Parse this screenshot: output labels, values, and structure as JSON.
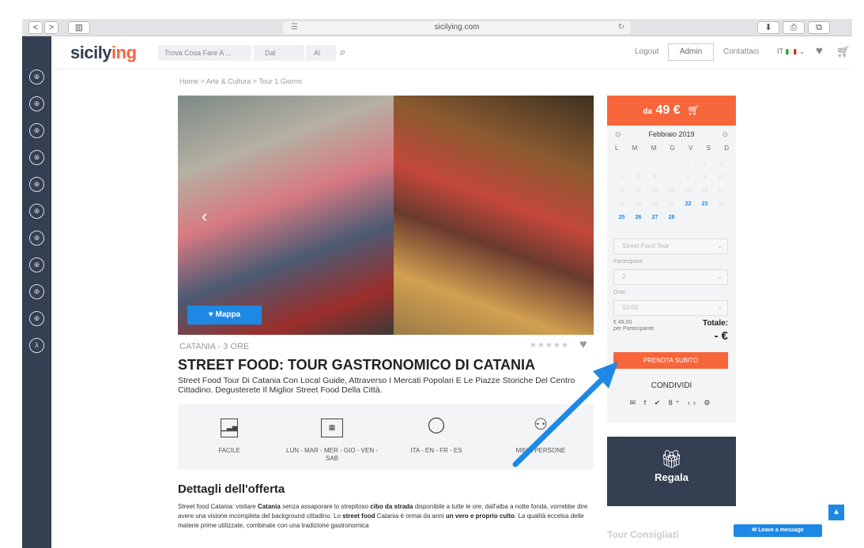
{
  "browser": {
    "url": "sicilying.com",
    "back": "<",
    "forward": ">",
    "sidebar_toggle": "▥",
    "menu": "☰",
    "reload": "↻"
  },
  "header": {
    "logo_main": "sicily",
    "logo_accent": "ing",
    "search_placeholder": "Trova Cosa Fare A ...",
    "from_placeholder": "Dal",
    "to_placeholder": "Al",
    "logout": "Logout",
    "admin": "Admin",
    "contacts": "Contattaci",
    "lang": "IT"
  },
  "breadcrumb": "Home > Arte & Cultura > Tour 1 Giorno",
  "hero": {
    "map_label": "♥ Mappa"
  },
  "tour": {
    "meta": "CATANIA - 3 ORE",
    "stars": "★★★★★",
    "title": "STREET FOOD: TOUR GASTRONOMICO DI CATANIA",
    "subtitle": "Street Food Tour Di Catania Con Local Guide, Attraverso I Mercati Popolari E Le Piazze Storiche Del Centro Cittadino. Degusterete Il Miglior Street Food Della Città."
  },
  "features": [
    {
      "label": "FACILE"
    },
    {
      "label": "LUN - MAR - MER - GIO - VEN - SAB"
    },
    {
      "label": "ITA - EN - FR - ES"
    },
    {
      "label": "MIN 2 PERSONE"
    }
  ],
  "details": {
    "heading": "Dettagli dell'offerta",
    "p1": "Street food Catania: visitare ",
    "b1": "Catania",
    "p2": " senza assaporare lo strepitoso ",
    "b2": "cibo da strada",
    "p3": " disponibile a tutte le ore, dall'alba a notte fonda, vorrebbe dire avere una visione incompleta del background cittadino. Lo ",
    "b3": "street food",
    "p4": " Catania è ormai da anni ",
    "b4": "un vero e proprio culto",
    "p5": ". La qualità eccelsa delle materie prime utilizzate, combinate con una tradizione gastronomica"
  },
  "booking": {
    "price_prefix": "da",
    "price": "49 €",
    "month": "Febbraio 2019",
    "prev": "⊙",
    "next": "⊙",
    "weekdays": [
      "L",
      "M",
      "M",
      "G",
      "V",
      "S",
      "D"
    ],
    "calendar": [
      [
        "",
        "",
        "",
        "",
        "1",
        "2",
        "3"
      ],
      [
        "4",
        "5",
        "6",
        "7",
        "8",
        "9",
        "10"
      ],
      [
        "11",
        "12",
        "13",
        "14",
        "15",
        "16",
        "17"
      ],
      [
        "18",
        "19",
        "20",
        "21",
        "22",
        "23",
        "24"
      ],
      [
        "25",
        "26",
        "27",
        "28",
        "",
        "",
        ""
      ]
    ],
    "available": [
      "22",
      "23",
      "25",
      "26",
      "27",
      "28"
    ],
    "tour_select": "Street Food Tour",
    "participants_label": "Partecipanti",
    "participants_value": "2",
    "time_label": "Orari",
    "time_value": "10:00",
    "unit_price": "€ 49,00",
    "unit_caption": "per Partecipante",
    "total_label": "Totale:",
    "total_value": "- €",
    "book_button": "PRENOTA SUBITO",
    "share_label": "CONDIVIDI",
    "share_icons": "✉ f ✔ 8⁺ ‹› ⚙"
  },
  "gift": {
    "label": "Regala"
  },
  "sidebar_bottom": {
    "tour_consigliati": "Tour Consigliati"
  },
  "chat": {
    "label": "Leave a message"
  },
  "colors": {
    "accent": "#f6663a",
    "navy": "#343f52",
    "blue": "#1e88e5"
  }
}
